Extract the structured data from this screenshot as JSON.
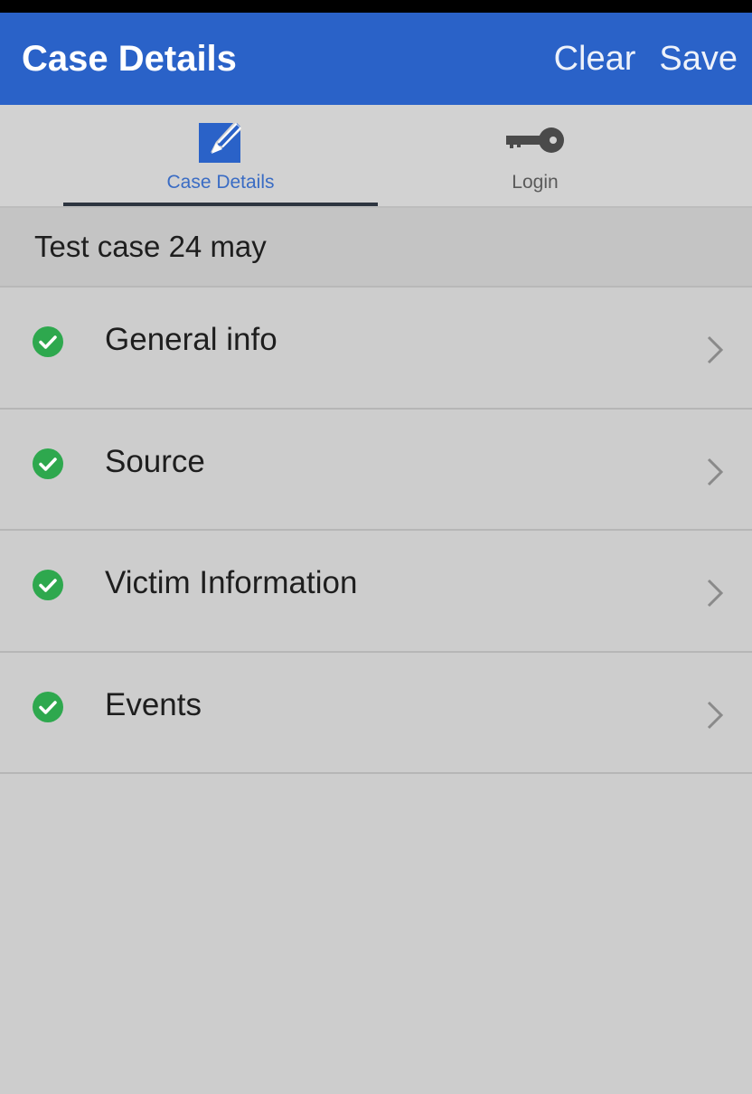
{
  "colors": {
    "accent": "#2a62c8",
    "check": "#2ea84e",
    "active_tab_label": "#3a6cc4"
  },
  "app_bar": {
    "title": "Case Details",
    "clear_label": "Clear",
    "save_label": "Save"
  },
  "tabs": [
    {
      "label": "Case Details",
      "icon": "edit-icon",
      "active": true
    },
    {
      "label": "Login",
      "icon": "key-icon",
      "active": false
    }
  ],
  "case": {
    "title": "Test case 24 may"
  },
  "sections": [
    {
      "label": "General info",
      "status": "complete",
      "icon": "check-circle-icon"
    },
    {
      "label": "Source",
      "status": "complete",
      "icon": "check-circle-icon"
    },
    {
      "label": "Victim Information",
      "status": "complete",
      "icon": "check-circle-icon"
    },
    {
      "label": "Events",
      "status": "complete",
      "icon": "check-circle-icon"
    }
  ]
}
